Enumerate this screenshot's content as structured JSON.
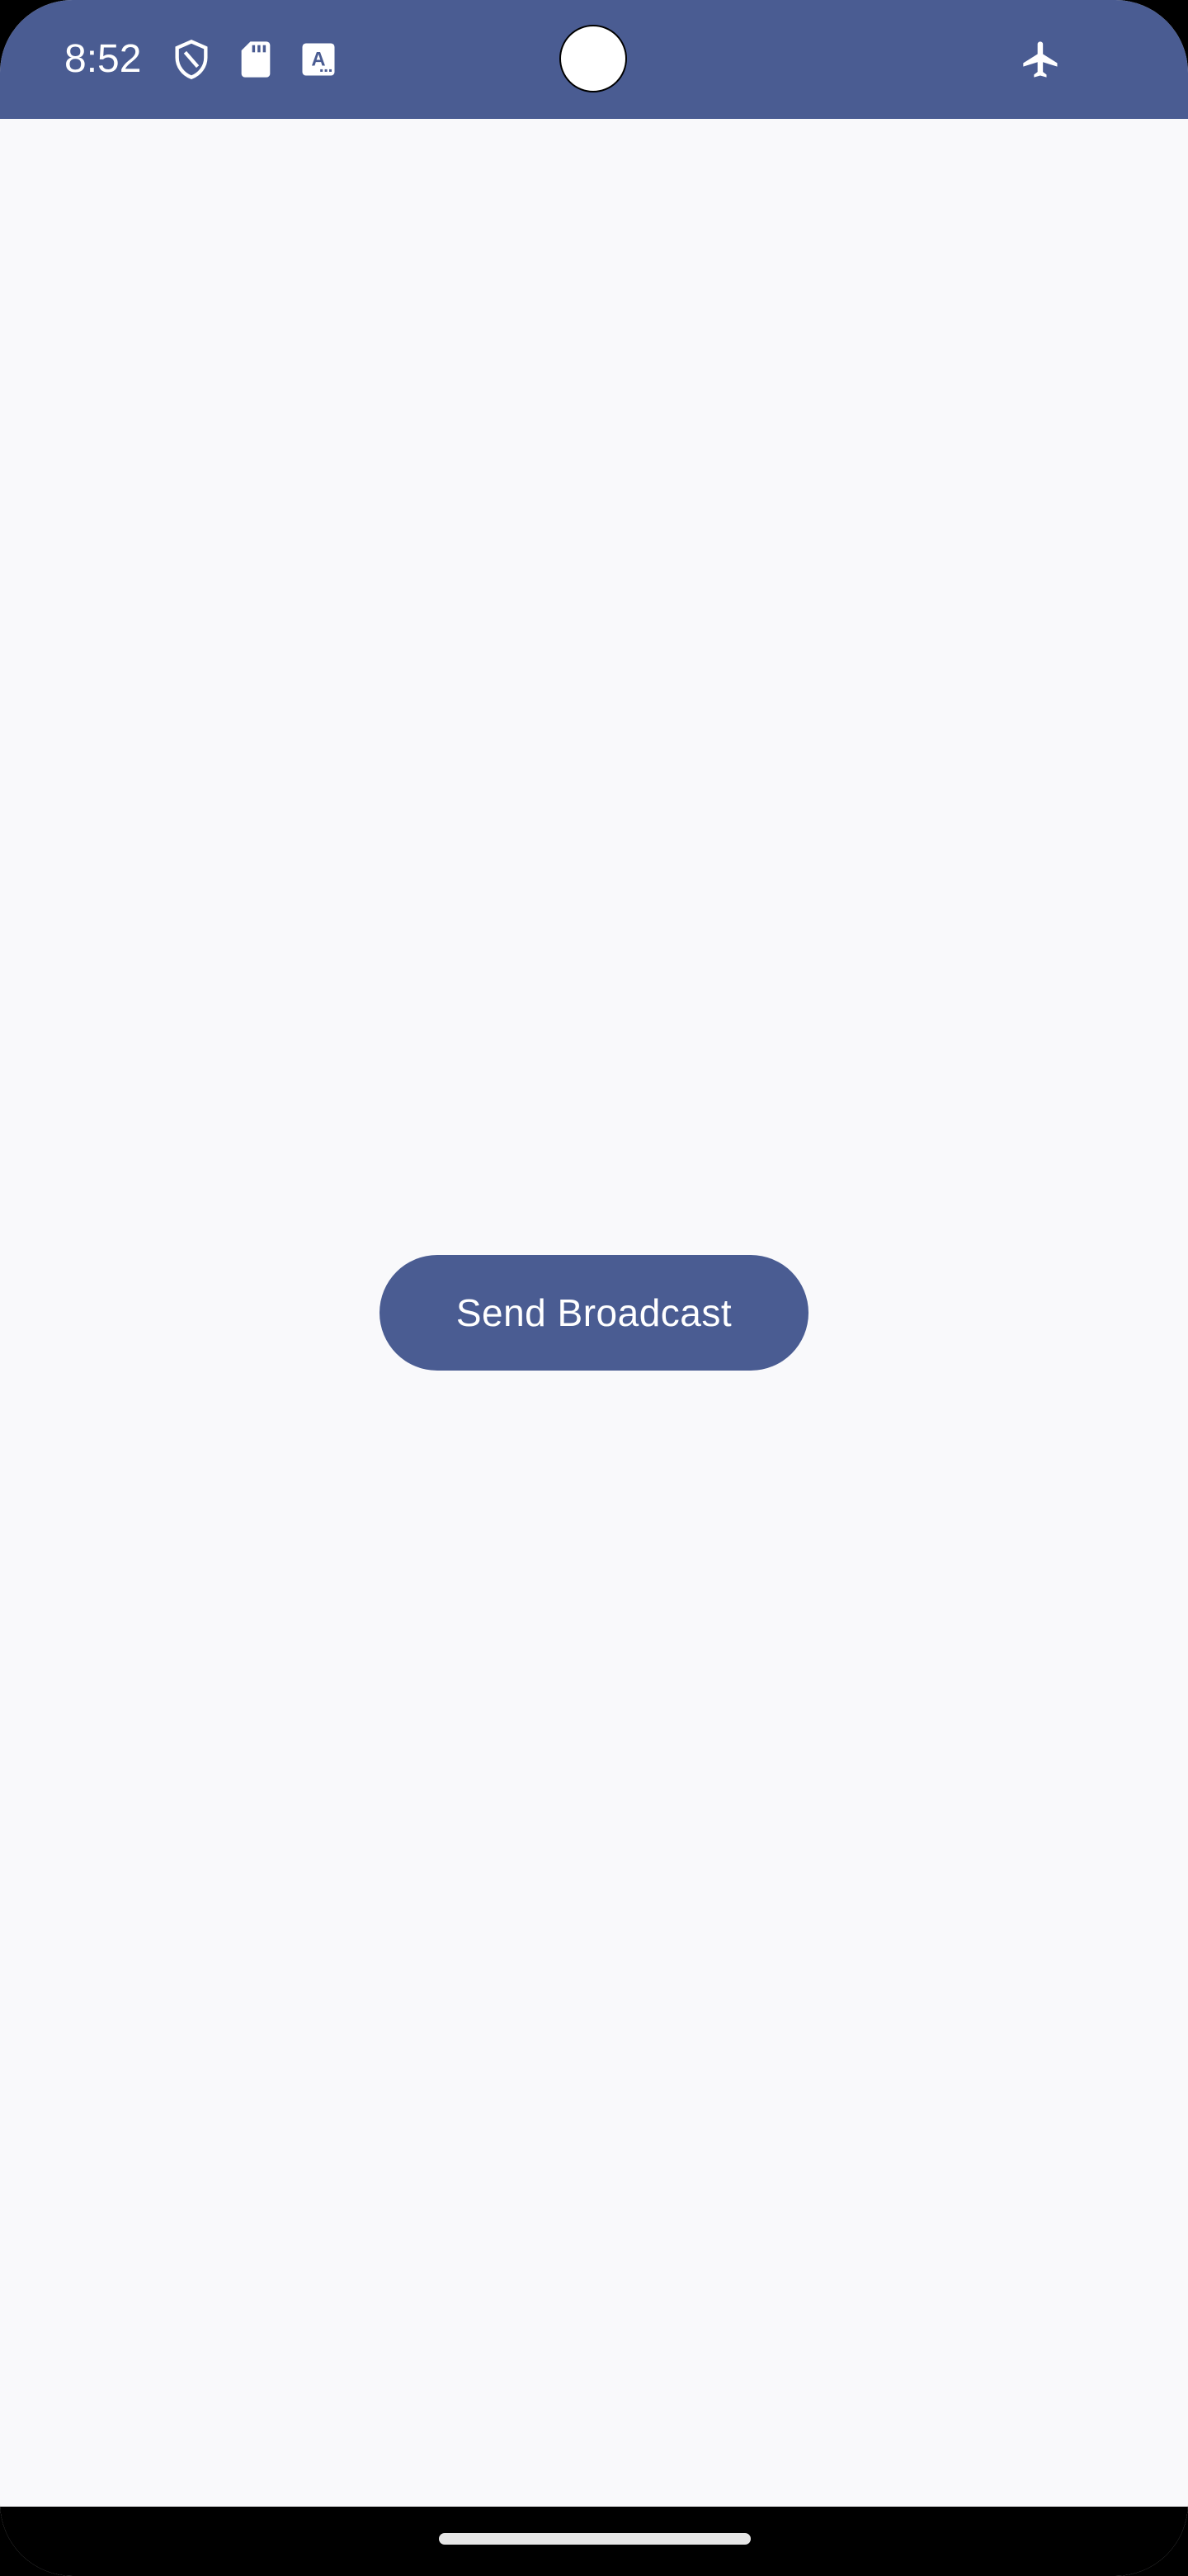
{
  "status_bar": {
    "time": "8:52",
    "icons": [
      "shield-icon",
      "sd-card-icon",
      "keyboard-a-icon",
      "airplane-mode-icon"
    ],
    "background_color": "#4a5c92"
  },
  "main": {
    "send_broadcast_label": "Send Broadcast",
    "button_color": "#4a5c92",
    "background_color": "#f9f9fb"
  },
  "navigation": {
    "handle": "home-handle"
  }
}
